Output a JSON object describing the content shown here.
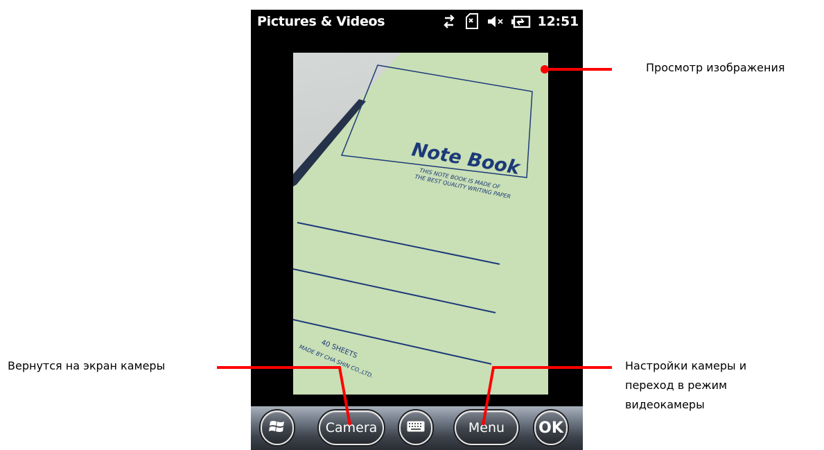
{
  "app": {
    "title": "Pictures & Videos",
    "clock": "12:51"
  },
  "status_icons": [
    "connectivity-icon",
    "no-sim-icon",
    "speaker-muted-icon",
    "battery-charging-icon"
  ],
  "photo": {
    "cover_title": "Note Book",
    "cover_line1": "THIS NOTE BOOK IS MADE OF",
    "cover_line2": "THE BEST QUALITY WRITING PAPER",
    "sheets": "40 SHEETS",
    "maker": "MADE BY  CHA SHIN CO.,LTD."
  },
  "softkeys": {
    "camera_label": "Camera",
    "menu_label": "Menu",
    "ok_label": "OK"
  },
  "annotations": {
    "image_view": "Просмотр изображения",
    "back_to_camera": "Вернутся на экран камеры",
    "settings_line1": "Настройки камеры и",
    "settings_line2": "переход в режим",
    "settings_line3": "видеокамеры"
  },
  "colors": {
    "annotation_line": "#ff0000",
    "notebook_cover": "#c9dfb6",
    "notebook_print": "#1c3a78"
  }
}
